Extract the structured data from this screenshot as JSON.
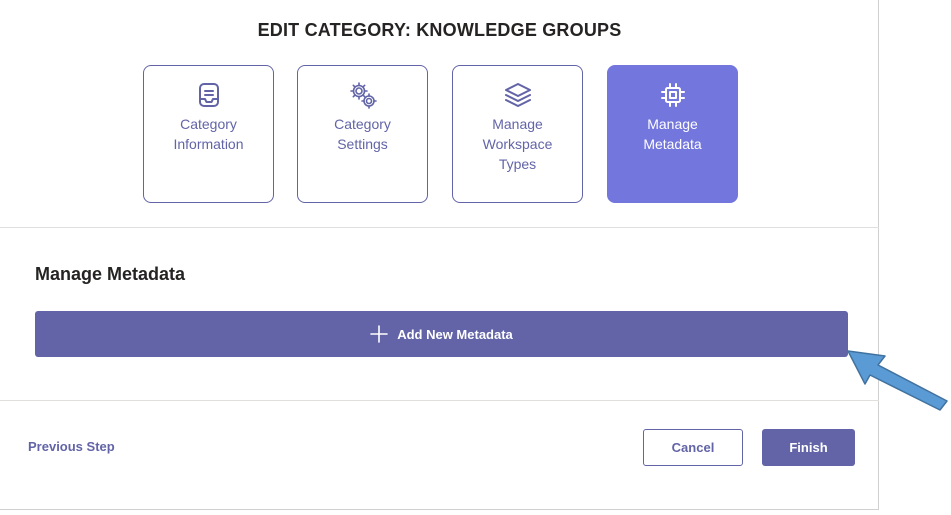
{
  "dialog": {
    "title": "EDIT CATEGORY: KNOWLEDGE GROUPS",
    "steps": [
      {
        "label": "Category Information",
        "icon": "inbox-icon",
        "active": false
      },
      {
        "label": "Category Settings",
        "icon": "gears-icon",
        "active": false
      },
      {
        "label": "Manage Workspace Types",
        "icon": "layers-icon",
        "active": false
      },
      {
        "label": "Manage Metadata",
        "icon": "chip-icon",
        "active": true
      }
    ],
    "section_title": "Manage Metadata",
    "add_button_label": "Add New Metadata",
    "previous_step_label": "Previous Step",
    "cancel_label": "Cancel",
    "finish_label": "Finish"
  },
  "colors": {
    "brand": "#6264a7",
    "active_step": "#7376dc",
    "annotation_arrow": "#5b9bd5"
  }
}
